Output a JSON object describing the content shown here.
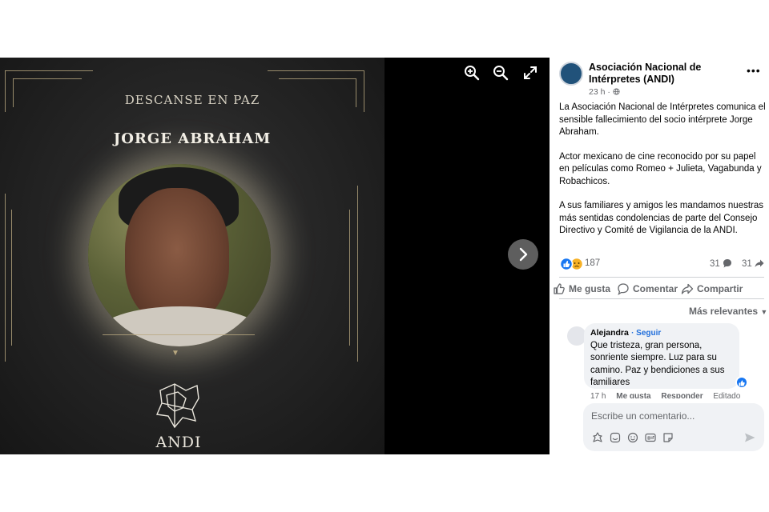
{
  "poster": {
    "subtitle": "DESCANSE EN PAZ",
    "name": "JORGE ABRAHAM",
    "logo_text": "ANDI",
    "accent": "#b8a77f"
  },
  "viewer": {
    "zoom_in_icon": "zoom-in-icon",
    "zoom_out_icon": "zoom-out-icon",
    "fullscreen_icon": "fullscreen-icon",
    "next_icon": "chevron-right-icon"
  },
  "post": {
    "page_name": "Asociación Nacional de Intérpretes (ANDI)",
    "time": "23 h ·",
    "privacy_icon": "globe-icon",
    "paragraphs": [
      "La Asociación Nacional de Intérpretes comunica el sensible fallecimiento del socio intérprete Jorge Abraham.",
      "Actor mexicano de cine reconocido por su papel en películas como Romeo + Julieta, Vagabunda y Robachicos.",
      "A sus familiares y amigos les mandamos nuestras más sentidas condolencias de parte del Consejo Directivo y Comité de Vigilancia de la ANDI."
    ],
    "reaction_count": "187",
    "comment_count": "31",
    "share_count": "31",
    "colors": {
      "link": "#216fdb",
      "like": "#1877f2",
      "muted": "#65676b"
    }
  },
  "actions": {
    "like": "Me gusta",
    "comment": "Comentar",
    "share": "Compartir"
  },
  "comments": {
    "filter": "Más relevantes",
    "items": [
      {
        "author": "Alejandra",
        "follow": "· Seguir",
        "text": "Que tristeza, gran persona, sonriente siempre. Luz para su camino. Paz y bendiciones a sus familiares",
        "time": "17 h",
        "like": "Me gusta",
        "reply": "Responder",
        "edited": "Editado"
      }
    ]
  },
  "composer": {
    "placeholder": "Escribe un comentario..."
  }
}
